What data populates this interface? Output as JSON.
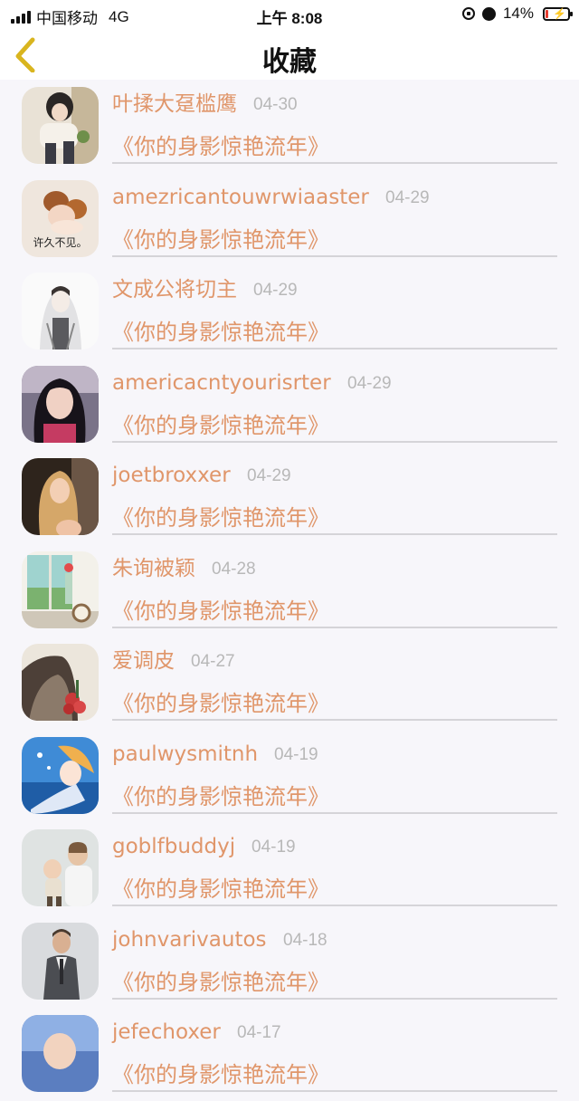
{
  "status_bar": {
    "carrier": "中国移动",
    "network": "4G",
    "time": "上午 8:08",
    "battery": "14%",
    "battery_level": 0.14
  },
  "nav": {
    "title": "收藏",
    "back_icon": "chevron-left-icon"
  },
  "colors": {
    "accent": "#e0966a",
    "date": "#b8b8b8",
    "divider": "#d5d4d8",
    "background": "#f7f6fa",
    "back_icon": "#d9b51f"
  },
  "favorites": [
    {
      "name": "叶揉大趸槛鹰",
      "date": "04-30",
      "title": "《你的身影惊艳流年》"
    },
    {
      "name": "amezricantouwrwiaaster",
      "date": "04-29",
      "title": "《你的身影惊艳流年》",
      "avatar_caption": "许久不见。"
    },
    {
      "name": "文成公将切主",
      "date": "04-29",
      "title": "《你的身影惊艳流年》"
    },
    {
      "name": "americacntyourisrter",
      "date": "04-29",
      "title": "《你的身影惊艳流年》"
    },
    {
      "name": "joetbroxxer",
      "date": "04-29",
      "title": "《你的身影惊艳流年》"
    },
    {
      "name": "朱询被颖",
      "date": "04-28",
      "title": "《你的身影惊艳流年》"
    },
    {
      "name": "爱调皮",
      "date": "04-27",
      "title": "《你的身影惊艳流年》"
    },
    {
      "name": "paulwysmitnh",
      "date": "04-19",
      "title": "《你的身影惊艳流年》"
    },
    {
      "name": "goblfbuddyj",
      "date": "04-19",
      "title": "《你的身影惊艳流年》"
    },
    {
      "name": "johnvarivautos",
      "date": "04-18",
      "title": "《你的身影惊艳流年》"
    },
    {
      "name": "jefechoxer",
      "date": "04-17",
      "title": "《你的身影惊艳流年》"
    }
  ]
}
